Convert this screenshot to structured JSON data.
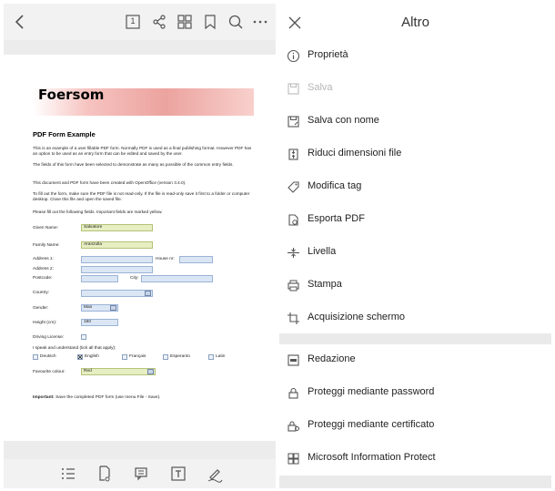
{
  "viewer": {
    "page_number": "1"
  },
  "document": {
    "logo_text": "Foersom",
    "title": "PDF Form Example",
    "p1": "This is an example of a user fillable PDF form. Normally PDF is used as a final publishing format. However PDF has an option to be used as an entry form that can be edited and saved by the user.",
    "p2": "The fields of this form have been selected to demonstrate as many as possible of the common entry fields.",
    "p3": "This document and PDF form have been created with OpenOffice (version 3.4.0).",
    "p4": "To fill out the form, make sure the PDF file is not read-only. If the file is read-only save it first to a folder or computer desktop. Close this file and open the saved file.",
    "p5": "Please fill out the following fields. Important fields are marked yellow.",
    "fields": {
      "given_name_label": "Given Name:",
      "given_name_value": "Salvatore",
      "family_name_label": "Family Name:",
      "family_name_value": "Aranzulla",
      "address1_label": "Address 1:",
      "house_nr_label": "House nr:",
      "address2_label": "Address 2:",
      "postcode_label": "Postcode:",
      "city_label": "City:",
      "country_label": "Country:",
      "gender_label": "Gender:",
      "gender_value": "Man",
      "height_label": "Height (cm):",
      "height_value": "150",
      "driving_license_label": "Driving License:",
      "languages_label": "I speak and understand (tick all that apply):",
      "lang_deutsch": "Deutsch",
      "lang_english": "English",
      "lang_francais": "Français",
      "lang_esperanto": "Esperanto",
      "lang_latin": "Latin",
      "colour_label": "Favourite colour:",
      "colour_value": "Red"
    },
    "important_label": "Important:",
    "important_text": "Save the completed PDF form (use menu File - Save)."
  },
  "menu": {
    "title": "Altro",
    "items": [
      {
        "label": "Proprietà",
        "icon": "info-icon",
        "enabled": true
      },
      {
        "label": "Salva",
        "icon": "save-icon",
        "enabled": false
      },
      {
        "label": "Salva con nome",
        "icon": "save-as-icon",
        "enabled": true
      },
      {
        "label": "Riduci dimensioni file",
        "icon": "compress-icon",
        "enabled": true
      },
      {
        "label": "Modifica tag",
        "icon": "tag-icon",
        "enabled": true
      },
      {
        "label": "Esporta PDF",
        "icon": "export-icon",
        "enabled": true
      },
      {
        "label": "Livella",
        "icon": "flatten-icon",
        "enabled": true
      },
      {
        "label": "Stampa",
        "icon": "print-icon",
        "enabled": true
      },
      {
        "label": "Acquisizione schermo",
        "icon": "crop-icon",
        "enabled": true
      },
      {
        "label": "Redazione",
        "icon": "redact-icon",
        "enabled": true
      },
      {
        "label": "Proteggi mediante password",
        "icon": "lock-icon",
        "enabled": true
      },
      {
        "label": "Proteggi mediante certificato",
        "icon": "certificate-lock-icon",
        "enabled": true
      },
      {
        "label": "Microsoft Information Protect",
        "icon": "microsoft-icon",
        "enabled": true
      }
    ]
  },
  "colors": {
    "toolbar_bg": "#f2f2f2",
    "disabled_text": "#b5b5b5",
    "required_field": "#e6eec2",
    "optional_field": "#dbe6f5"
  }
}
